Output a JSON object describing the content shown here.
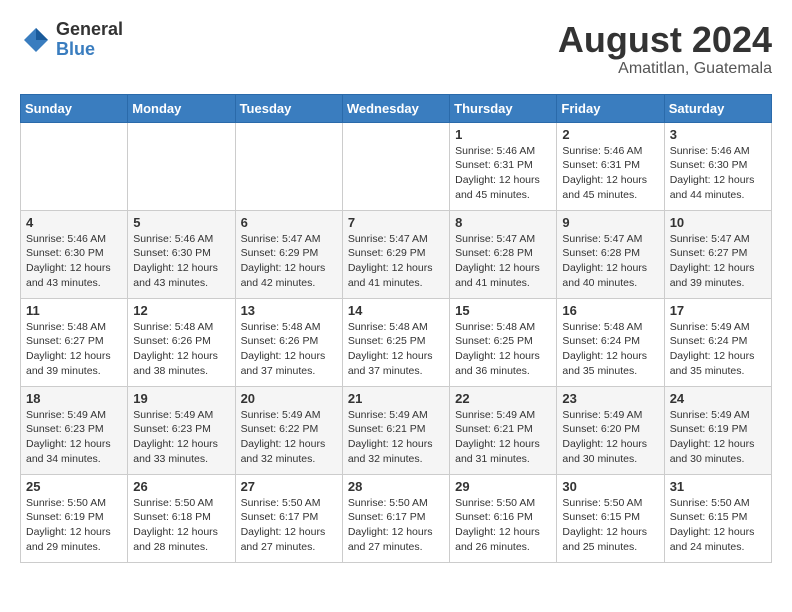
{
  "logo": {
    "general": "General",
    "blue": "Blue"
  },
  "title": {
    "month_year": "August 2024",
    "location": "Amatitlan, Guatemala"
  },
  "weekdays": [
    "Sunday",
    "Monday",
    "Tuesday",
    "Wednesday",
    "Thursday",
    "Friday",
    "Saturday"
  ],
  "weeks": [
    [
      {
        "day": "",
        "info": ""
      },
      {
        "day": "",
        "info": ""
      },
      {
        "day": "",
        "info": ""
      },
      {
        "day": "",
        "info": ""
      },
      {
        "day": "1",
        "info": "Sunrise: 5:46 AM\nSunset: 6:31 PM\nDaylight: 12 hours\nand 45 minutes."
      },
      {
        "day": "2",
        "info": "Sunrise: 5:46 AM\nSunset: 6:31 PM\nDaylight: 12 hours\nand 45 minutes."
      },
      {
        "day": "3",
        "info": "Sunrise: 5:46 AM\nSunset: 6:30 PM\nDaylight: 12 hours\nand 44 minutes."
      }
    ],
    [
      {
        "day": "4",
        "info": "Sunrise: 5:46 AM\nSunset: 6:30 PM\nDaylight: 12 hours\nand 43 minutes."
      },
      {
        "day": "5",
        "info": "Sunrise: 5:46 AM\nSunset: 6:30 PM\nDaylight: 12 hours\nand 43 minutes."
      },
      {
        "day": "6",
        "info": "Sunrise: 5:47 AM\nSunset: 6:29 PM\nDaylight: 12 hours\nand 42 minutes."
      },
      {
        "day": "7",
        "info": "Sunrise: 5:47 AM\nSunset: 6:29 PM\nDaylight: 12 hours\nand 41 minutes."
      },
      {
        "day": "8",
        "info": "Sunrise: 5:47 AM\nSunset: 6:28 PM\nDaylight: 12 hours\nand 41 minutes."
      },
      {
        "day": "9",
        "info": "Sunrise: 5:47 AM\nSunset: 6:28 PM\nDaylight: 12 hours\nand 40 minutes."
      },
      {
        "day": "10",
        "info": "Sunrise: 5:47 AM\nSunset: 6:27 PM\nDaylight: 12 hours\nand 39 minutes."
      }
    ],
    [
      {
        "day": "11",
        "info": "Sunrise: 5:48 AM\nSunset: 6:27 PM\nDaylight: 12 hours\nand 39 minutes."
      },
      {
        "day": "12",
        "info": "Sunrise: 5:48 AM\nSunset: 6:26 PM\nDaylight: 12 hours\nand 38 minutes."
      },
      {
        "day": "13",
        "info": "Sunrise: 5:48 AM\nSunset: 6:26 PM\nDaylight: 12 hours\nand 37 minutes."
      },
      {
        "day": "14",
        "info": "Sunrise: 5:48 AM\nSunset: 6:25 PM\nDaylight: 12 hours\nand 37 minutes."
      },
      {
        "day": "15",
        "info": "Sunrise: 5:48 AM\nSunset: 6:25 PM\nDaylight: 12 hours\nand 36 minutes."
      },
      {
        "day": "16",
        "info": "Sunrise: 5:48 AM\nSunset: 6:24 PM\nDaylight: 12 hours\nand 35 minutes."
      },
      {
        "day": "17",
        "info": "Sunrise: 5:49 AM\nSunset: 6:24 PM\nDaylight: 12 hours\nand 35 minutes."
      }
    ],
    [
      {
        "day": "18",
        "info": "Sunrise: 5:49 AM\nSunset: 6:23 PM\nDaylight: 12 hours\nand 34 minutes."
      },
      {
        "day": "19",
        "info": "Sunrise: 5:49 AM\nSunset: 6:23 PM\nDaylight: 12 hours\nand 33 minutes."
      },
      {
        "day": "20",
        "info": "Sunrise: 5:49 AM\nSunset: 6:22 PM\nDaylight: 12 hours\nand 32 minutes."
      },
      {
        "day": "21",
        "info": "Sunrise: 5:49 AM\nSunset: 6:21 PM\nDaylight: 12 hours\nand 32 minutes."
      },
      {
        "day": "22",
        "info": "Sunrise: 5:49 AM\nSunset: 6:21 PM\nDaylight: 12 hours\nand 31 minutes."
      },
      {
        "day": "23",
        "info": "Sunrise: 5:49 AM\nSunset: 6:20 PM\nDaylight: 12 hours\nand 30 minutes."
      },
      {
        "day": "24",
        "info": "Sunrise: 5:49 AM\nSunset: 6:19 PM\nDaylight: 12 hours\nand 30 minutes."
      }
    ],
    [
      {
        "day": "25",
        "info": "Sunrise: 5:50 AM\nSunset: 6:19 PM\nDaylight: 12 hours\nand 29 minutes."
      },
      {
        "day": "26",
        "info": "Sunrise: 5:50 AM\nSunset: 6:18 PM\nDaylight: 12 hours\nand 28 minutes."
      },
      {
        "day": "27",
        "info": "Sunrise: 5:50 AM\nSunset: 6:17 PM\nDaylight: 12 hours\nand 27 minutes."
      },
      {
        "day": "28",
        "info": "Sunrise: 5:50 AM\nSunset: 6:17 PM\nDaylight: 12 hours\nand 27 minutes."
      },
      {
        "day": "29",
        "info": "Sunrise: 5:50 AM\nSunset: 6:16 PM\nDaylight: 12 hours\nand 26 minutes."
      },
      {
        "day": "30",
        "info": "Sunrise: 5:50 AM\nSunset: 6:15 PM\nDaylight: 12 hours\nand 25 minutes."
      },
      {
        "day": "31",
        "info": "Sunrise: 5:50 AM\nSunset: 6:15 PM\nDaylight: 12 hours\nand 24 minutes."
      }
    ]
  ]
}
